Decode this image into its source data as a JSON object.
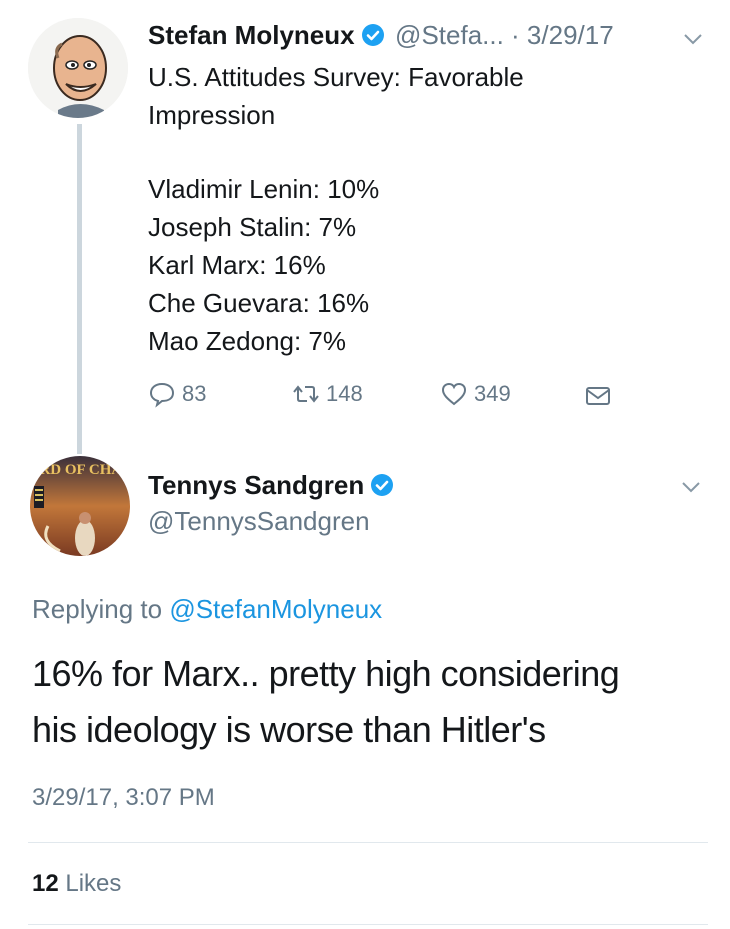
{
  "tweet1": {
    "author_name": "Stefan Molyneux",
    "handle_date": "@Stefa... · 3/29/17",
    "title": "U.S. Attitudes Survey: Favorable\nImpression",
    "lines": [
      "Vladimir Lenin: 10%",
      "Joseph Stalin: 7%",
      "Karl Marx: 16%",
      "Che Guevara: 16%",
      "Mao Zedong: 7%"
    ],
    "replies": "83",
    "retweets": "148",
    "likes": "349",
    "icons": [
      "verified-badge-icon",
      "chevron-down-icon",
      "reply-icon",
      "retweet-icon",
      "heart-icon",
      "message-icon"
    ]
  },
  "tweet2": {
    "author_name": "Tennys Sandgren",
    "handle": "@TennysSandgren",
    "replying_prefix": "Replying to ",
    "replying_handle": "@StefanMolyneux",
    "text": "16% for Marx.. pretty high considering\nhis ideology is worse than Hitler's",
    "timestamp": "3/29/17, 3:07 PM",
    "likes_count": "12",
    "likes_label": "Likes",
    "avatar_text": "LORD OF CHAOS"
  },
  "colors": {
    "text": "#14171a",
    "secondary": "#657786",
    "link": "#1b95e0",
    "verified": "#1da1f2",
    "divider": "#e1e8ed",
    "thread": "#ccd6dd"
  }
}
